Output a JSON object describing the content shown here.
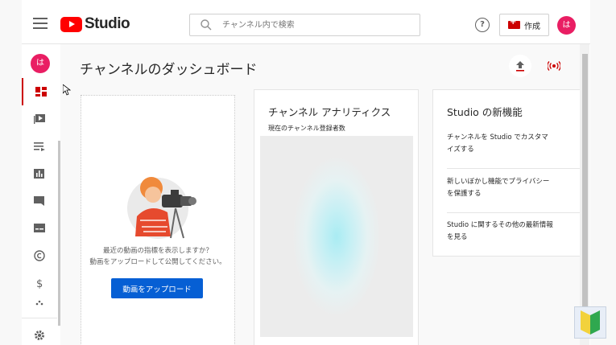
{
  "app": {
    "logo_text": "Studio"
  },
  "header": {
    "search_placeholder": "チャンネル内で検索",
    "create_label": "作成",
    "avatar_initial": "は"
  },
  "sidebar": {
    "avatar_initial": "は",
    "items": [
      {
        "icon": "dashboard-icon",
        "active": true
      },
      {
        "icon": "content-icon"
      },
      {
        "icon": "playlists-icon"
      },
      {
        "icon": "analytics-icon"
      },
      {
        "icon": "comments-icon"
      },
      {
        "icon": "subtitles-icon"
      },
      {
        "icon": "copyright-icon"
      },
      {
        "icon": "monetization-icon"
      },
      {
        "icon": "customization-icon"
      },
      {
        "icon": "settings-icon"
      }
    ]
  },
  "main": {
    "page_title": "チャンネルのダッシュボード",
    "upload_card": {
      "prompt_line1": "最近の動画の指標を表示しますか？",
      "prompt_line2": "動画をアップロードして公開してください。",
      "button_label": "動画をアップロード"
    },
    "analytics_card": {
      "title": "チャンネル アナリティクス",
      "subscribers_label": "現在のチャンネル登録者数"
    },
    "news_card": {
      "title": "Studio の新機能",
      "items": [
        {
          "line1": "チャンネルを Studio でカスタマ",
          "line2": "イズする"
        },
        {
          "line1": "新しいぼかし機能でプライバシー",
          "line2": "を保護する"
        },
        {
          "line1": "Studio に関するその他の最新情報",
          "line2": "を見る"
        }
      ]
    }
  },
  "colors": {
    "accent_red": "#cc0000",
    "brand_red": "#ff0000",
    "primary_blue": "#065fd4",
    "avatar_pink": "#e91e63"
  }
}
